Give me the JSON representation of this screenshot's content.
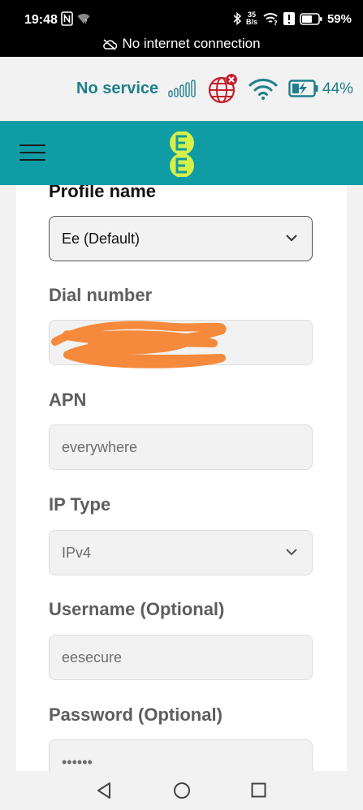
{
  "status_bar": {
    "time": "19:48",
    "speed_top": "35",
    "speed_bottom": "B/s",
    "battery_percent": "59%",
    "notification": "No internet connection"
  },
  "router_status": {
    "service_text": "No service",
    "battery_percent": "44%",
    "accent_color": "#1f7f8c",
    "icons": [
      "signal-bars-icon",
      "globe-disconnected-icon",
      "wifi-icon",
      "battery-charging-icon"
    ]
  },
  "header": {
    "logo_text": "EE",
    "menu_icon": "hamburger-menu-icon",
    "brand_color": "#0f9ca4",
    "logo_color": "#d6f04a"
  },
  "form": {
    "profile_name": {
      "label": "Profile name",
      "value": "Ee (Default)"
    },
    "dial_number": {
      "label": "Dial number",
      "value_redacted": true
    },
    "apn": {
      "label": "APN",
      "value": "everywhere"
    },
    "ip_type": {
      "label": "IP Type",
      "value": "IPv4"
    },
    "username": {
      "label": "Username (Optional)",
      "value": "eesecure"
    },
    "password": {
      "label": "Password (Optional)",
      "value": "••••••"
    }
  },
  "nav_bar": {
    "icons": [
      "back-icon",
      "home-icon",
      "recents-icon"
    ]
  }
}
